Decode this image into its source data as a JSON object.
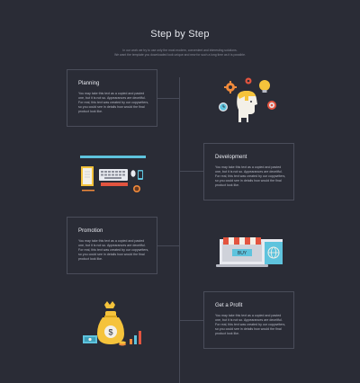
{
  "header": {
    "title": "Step by Step",
    "subtitle_line1": "In our work we try to use only the most modern, convenient and interesting solutions.",
    "subtitle_line2": "We want the template you downloaded look unique and new for such a long time as it is possible."
  },
  "steps": [
    {
      "title": "Planning",
      "text": "You may take this text as a copied and pasted one, but it is not so. Appearances are deceitful. For real, this text was created by our copywriters, so you could see in details how would the final product look like."
    },
    {
      "title": "Development",
      "text": "You may take this text as a copied and pasted one, but it is not so. Appearances are deceitful. For real, this text was created by our copywriters, so you could see in details how would the final product look like."
    },
    {
      "title": "Promotion",
      "text": "You may take this text as a copied and pasted one, but it is not so. Appearances are deceitful. For real, this text was created by our copywriters, so you could see in details how would the final product look like."
    },
    {
      "title": "Get a Profit",
      "text": "You may take this text as a copied and pasted one, but it is not so. Appearances are deceitful. For real, this text was created by our copywriters, so you could see in details how would the final product look like."
    }
  ],
  "illustrations": {
    "shop_sign": "BUY",
    "money_symbol": "$"
  },
  "colors": {
    "background": "#2a2c36",
    "card_border": "#4a4d5a",
    "accent_yellow": "#f5c33b",
    "accent_blue": "#5ec3dd",
    "accent_red": "#e3543f",
    "accent_orange": "#f08a3c"
  }
}
